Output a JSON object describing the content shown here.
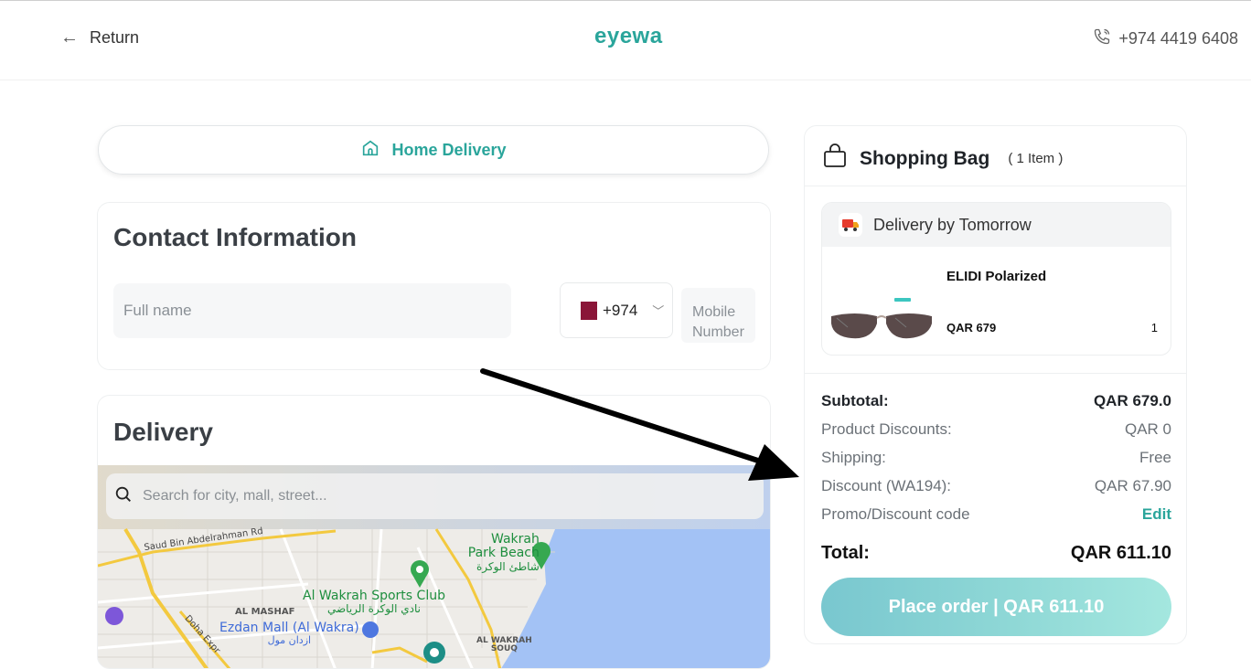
{
  "header": {
    "return_label": "Return",
    "logo_text": "eyewa",
    "phone": "+974 4419 6408"
  },
  "tabs": {
    "home_delivery": "Home Delivery"
  },
  "contact": {
    "title": "Contact Information",
    "fullname_placeholder": "Full name",
    "country_code": "+974",
    "mobile_placeholder_1": "Mobile",
    "mobile_placeholder_2": "Number"
  },
  "delivery": {
    "title": "Delivery",
    "search_placeholder": "Search for city, mall, street...",
    "map_labels": {
      "road": "Saud Bin Abdelrahman Rd",
      "beach_en_1": "Wakrah",
      "beach_en_2": "Park Beach",
      "beach_ar": "شاطئ الوكرة",
      "club_en": "Al Wakrah Sports Club",
      "club_ar": "نادي الوكرة الرياضي",
      "mashaf": "AL MASHAF",
      "mall_en": "Ezdan Mall (Al Wakra)",
      "mall_ar": "ازدان مول",
      "souq_1": "AL WAKRAH",
      "souq_2": "SOUQ",
      "expressway": "Doha Expr"
    }
  },
  "bag": {
    "title": "Shopping Bag",
    "count": "( 1 Item )",
    "delivery_label": "Delivery by Tomorrow",
    "item": {
      "name": "ELIDI Polarized",
      "price": "QAR 679",
      "qty": "1"
    },
    "summary": {
      "subtotal_label": "Subtotal:",
      "subtotal_value": "QAR 679.0",
      "discounts_label": "Product Discounts:",
      "discounts_value": "QAR 0",
      "shipping_label": "Shipping:",
      "shipping_value": "Free",
      "code_discount_label": "Discount (WA194):",
      "code_discount_value": "QAR 67.90",
      "promo_label": "Promo/Discount code",
      "promo_action": "Edit",
      "total_label": "Total:",
      "total_value": "QAR 611.10"
    },
    "place_order": "Place order | QAR 611.10"
  },
  "colors": {
    "accent": "#2aa59b",
    "button_start": "#79c7cf",
    "button_end": "#a4e7df",
    "qatar_maroon": "#8a1538",
    "water": "#a3c2f5"
  }
}
